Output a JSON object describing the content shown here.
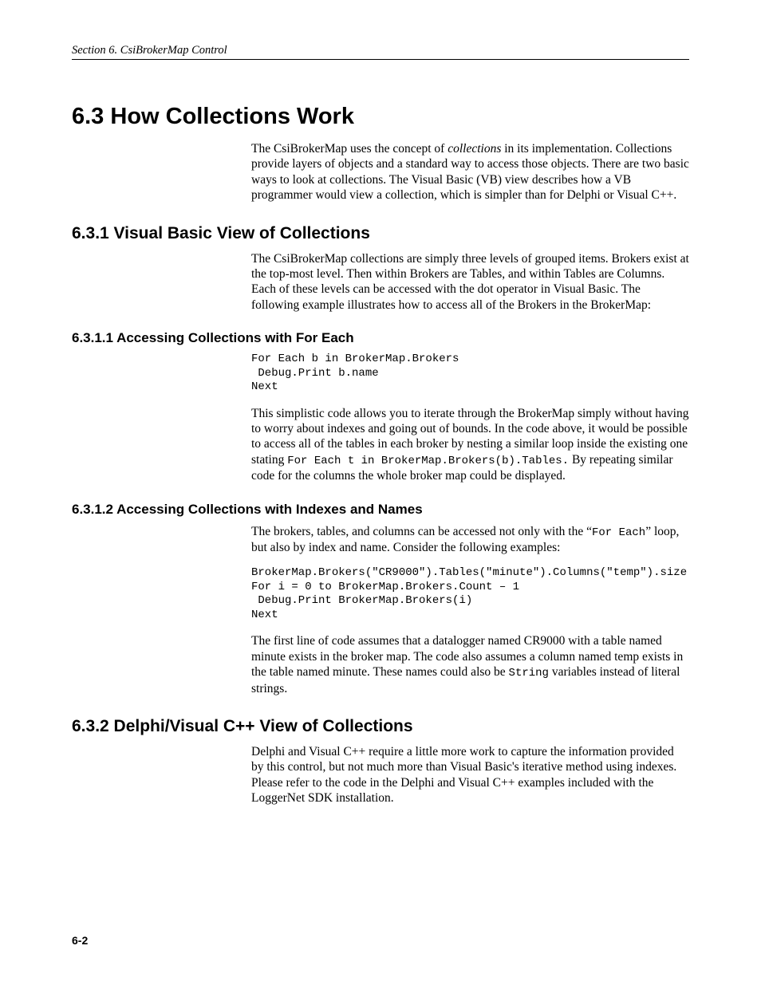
{
  "header": {
    "running": "Section 6.  CsiBrokerMap Control"
  },
  "h1": "6.3  How Collections Work",
  "p1a": "The CsiBrokerMap uses the concept of ",
  "p1b": "collections",
  "p1c": " in its implementation.  Collections provide layers of objects and a standard way to access those objects.  There are two basic ways to look at collections.  The Visual Basic (VB) view describes how a VB programmer would view a collection, which is simpler than for Delphi or Visual C++.",
  "h2_1": "6.3.1  Visual Basic View of Collections",
  "p2": "The CsiBrokerMap collections are simply three levels of grouped items.  Brokers exist at the top-most level.  Then within Brokers are Tables, and within Tables are Columns. Each of these levels can be accessed with the dot operator in Visual Basic.  The following example illustrates how to access all of the Brokers in the BrokerMap:",
  "h3_1": "6.3.1.1  Accessing Collections with For Each",
  "code1": "For Each b in BrokerMap.Brokers\n Debug.Print b.name\nNext",
  "p3a": "This simplistic code allows you to iterate through the BrokerMap simply without having to worry about indexes and going out of bounds.  In the code above, it would be possible to access all of the tables in each broker by nesting a similar loop inside the existing one stating ",
  "p3b": "For Each t in BrokerMap.Brokers(b).Tables.",
  "p3c": "    By repeating similar code for the columns the whole broker map could be displayed.",
  "h3_2": "6.3.1.2  Accessing Collections with Indexes and Names",
  "p4a": "The brokers, tables, and columns can be accessed not only with the “",
  "p4b": "For Each",
  "p4c": "” loop, but also by index and name. Consider the following examples:",
  "code2": "BrokerMap.Brokers(\"CR9000\").Tables(\"minute\").Columns(\"temp\").size\nFor i = 0 to BrokerMap.Brokers.Count – 1\n Debug.Print BrokerMap.Brokers(i)\nNext",
  "p5a": "The first line of code assumes that a datalogger named CR9000 with a table named minute exists in the broker map.  The code also assumes a column named temp exists in the table named minute.  These names could also be ",
  "p5b": "String",
  "p5c": " variables instead of literal strings.",
  "h2_2": "6.3.2  Delphi/Visual C++ View of Collections",
  "p6": "Delphi and Visual C++ require a little more work to capture the information provided by this control, but not much more than Visual Basic's iterative method using indexes.  Please refer to the code in the Delphi and Visual C++ examples included with the LoggerNet SDK installation.",
  "footer": "6-2"
}
